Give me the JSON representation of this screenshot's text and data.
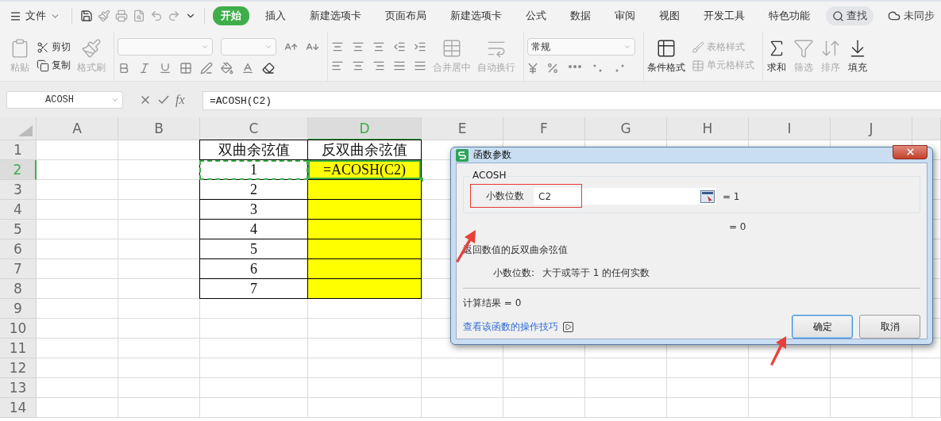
{
  "menu_bar": {
    "file_menu": "文件",
    "tabs": [
      {
        "label": "开始",
        "selected": true
      },
      {
        "label": "插入",
        "selected": false
      },
      {
        "label": "新建选项卡",
        "selected": false
      },
      {
        "label": "页面布局",
        "selected": false
      },
      {
        "label": "新建选项卡",
        "selected": false
      },
      {
        "label": "公式",
        "selected": false
      },
      {
        "label": "数据",
        "selected": false
      },
      {
        "label": "审阅",
        "selected": false
      },
      {
        "label": "视图",
        "selected": false
      },
      {
        "label": "开发工具",
        "selected": false
      },
      {
        "label": "特色功能",
        "selected": false
      }
    ],
    "search": "查找",
    "sync_status": "未同步"
  },
  "ribbon": {
    "clipboard": [
      {
        "label": "粘贴",
        "kind": "large",
        "disabled": true
      },
      {
        "label": "剪切",
        "kind": "small",
        "disabled": false
      },
      {
        "label": "复制",
        "kind": "small",
        "disabled": false
      },
      {
        "label": "格式刷",
        "kind": "large",
        "disabled": true
      }
    ],
    "alignment": [
      {
        "label": "合并居中",
        "disabled": true
      },
      {
        "label": "自动换行",
        "disabled": true
      }
    ],
    "number_format": {
      "value": "常规"
    },
    "styles": [
      {
        "label": "条件格式",
        "kind": "large",
        "disabled": false
      },
      {
        "label": "表格样式",
        "kind": "small",
        "disabled": true
      },
      {
        "label": "单元格样式",
        "kind": "small",
        "disabled": true
      }
    ],
    "editing": [
      {
        "label": "求和",
        "disabled": false
      },
      {
        "label": "筛选",
        "disabled": true
      },
      {
        "label": "排序",
        "disabled": true
      },
      {
        "label": "填充",
        "disabled": false
      }
    ]
  },
  "formula_bar": {
    "name_box": "ACOSH",
    "function_button": "fx",
    "formula": "=ACOSH(C2)"
  },
  "sheet": {
    "columns": [
      {
        "label": "A",
        "selected": false
      },
      {
        "label": "B",
        "selected": false
      },
      {
        "label": "C",
        "selected": false
      },
      {
        "label": "D",
        "selected": true
      },
      {
        "label": "E",
        "selected": false
      },
      {
        "label": "F",
        "selected": false
      },
      {
        "label": "G",
        "selected": false
      },
      {
        "label": "H",
        "selected": false
      },
      {
        "label": "I",
        "selected": false
      },
      {
        "label": "J",
        "selected": false
      }
    ],
    "rows": [
      {
        "label": "1",
        "selected": false
      },
      {
        "label": "2",
        "selected": true
      },
      {
        "label": "3",
        "selected": false
      },
      {
        "label": "4",
        "selected": false
      },
      {
        "label": "5",
        "selected": false
      },
      {
        "label": "6",
        "selected": false
      },
      {
        "label": "7",
        "selected": false
      },
      {
        "label": "8",
        "selected": false
      },
      {
        "label": "9",
        "selected": false
      },
      {
        "label": "10",
        "selected": false
      },
      {
        "label": "11",
        "selected": false
      },
      {
        "label": "12",
        "selected": false
      },
      {
        "label": "13",
        "selected": false
      },
      {
        "label": "14",
        "selected": false
      }
    ],
    "table": [
      [
        {
          "text": "双曲余弦值",
          "highlighted": false,
          "active": false,
          "marquee": false
        },
        {
          "text": "反双曲余弦值",
          "highlighted": false,
          "active": false,
          "marquee": false
        }
      ],
      [
        {
          "text": "1",
          "highlighted": false,
          "active": false,
          "marquee": true
        },
        {
          "text": "=ACOSH(C2)",
          "highlighted": true,
          "active": true,
          "marquee": false
        }
      ],
      [
        {
          "text": "2",
          "highlighted": false,
          "active": false,
          "marquee": false
        },
        {
          "highlighted": true,
          "active": false,
          "marquee": false
        }
      ],
      [
        {
          "text": "3",
          "highlighted": false,
          "active": false,
          "marquee": false
        },
        {
          "highlighted": true,
          "active": false,
          "marquee": false
        }
      ],
      [
        {
          "text": "4",
          "highlighted": false,
          "active": false,
          "marquee": false
        },
        {
          "highlighted": true,
          "active": false,
          "marquee": false
        }
      ],
      [
        {
          "text": "5",
          "highlighted": false,
          "active": false,
          "marquee": false
        },
        {
          "highlighted": true,
          "active": false,
          "marquee": false
        }
      ],
      [
        {
          "text": "6",
          "highlighted": false,
          "active": false,
          "marquee": false
        },
        {
          "highlighted": true,
          "active": false,
          "marquee": false
        }
      ],
      [
        {
          "text": "7",
          "highlighted": false,
          "active": false,
          "marquee": false
        },
        {
          "highlighted": true,
          "active": false,
          "marquee": false
        }
      ]
    ]
  },
  "dialog": {
    "title": "函数参数",
    "function_name": "ACOSH",
    "argument": {
      "label": "小数位数",
      "value": "C2",
      "result": "= 1"
    },
    "formula_result": "= 0",
    "description": "返回数值的反双曲余弦值",
    "argument_help": {
      "label": "小数位数:",
      "text": "大于或等于 1 的任何实数"
    },
    "calculation_result": "计算结果 = 0",
    "help_link": "查看该函数的操作技巧",
    "buttons": [
      {
        "label": "确定",
        "selected": true
      },
      {
        "label": "取消",
        "selected": false
      }
    ]
  }
}
